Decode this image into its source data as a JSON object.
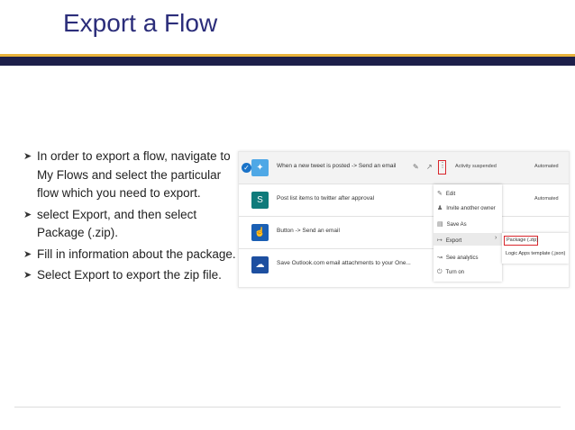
{
  "slide": {
    "title": "Export a Flow",
    "bullets": [
      "In order to export a flow, navigate to My Flows and select the particular flow which you need to export.",
      "select Export, and then select Package (.zip).",
      "Fill in information about the package.",
      "Select Export to export the zip file."
    ]
  },
  "screenshot": {
    "rows": [
      {
        "icon": "twitter-icon",
        "title": "When a new tweet is posted -> Send an email",
        "status": "Activity suspended",
        "type": "Automated"
      },
      {
        "icon": "sharepoint-icon",
        "title": "Post list items to twitter after approval",
        "type": "Automated"
      },
      {
        "icon": "button-icon",
        "title": "Button -> Send an email"
      },
      {
        "icon": "onedrive-icon",
        "title": "Save Outlook.com email attachments to your One..."
      }
    ],
    "menu": [
      "Edit",
      "Invite another owner",
      "Save As",
      "Export",
      "See analytics",
      "Turn on"
    ],
    "submenu": [
      "Package (.zip)",
      "Logic Apps template (.json)"
    ]
  },
  "colors": {
    "title": "#2b2d7a",
    "accent_bar": "#e8b33c",
    "header_bar": "#1d1f4a",
    "highlight_red": "#d9262c"
  }
}
